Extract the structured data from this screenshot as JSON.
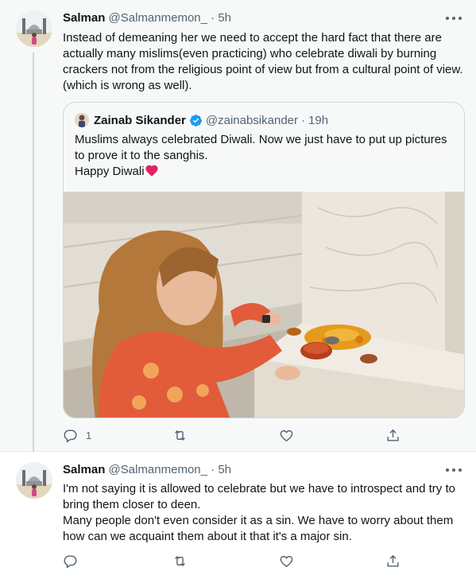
{
  "tweets": [
    {
      "author_name": "Salman",
      "author_handle": "@Salmanmemon_",
      "separator": "·",
      "time": "5h",
      "text": "Instead of demeaning her we need to accept the hard fact that there are actually many mislims(even practicing) who celebrate diwali by burning crackers not from the religious point of view but from a cultural point of view.(which is wrong as well).",
      "quote": {
        "author_name": "Zainab Sikander",
        "author_handle": "@zainabsikander",
        "separator": "·",
        "time": "19h",
        "line1": "Muslims always celebrated Diwali. Now we just have to put up pictures to prove it to the sanghis.",
        "line2": "Happy Diwali"
      },
      "reply_count": "1"
    },
    {
      "author_name": "Salman",
      "author_handle": "@Salmanmemon_",
      "separator": "·",
      "time": "5h",
      "text1": "I'm not saying it is allowed to celebrate but we have to introspect and try to bring them closer to deen.",
      "text2": "Many people don't even consider it as a sin. We have to worry about them how can we acquaint them about it that it's a major sin."
    }
  ],
  "colors": {
    "accent": "#1d9bf0",
    "heart": "#e0245e",
    "muted": "#536471",
    "thread_bg": "#f7f9f9"
  },
  "icons": [
    "more-icon",
    "verified-icon",
    "heart-emoji-icon",
    "reply-icon",
    "retweet-icon",
    "like-icon",
    "share-icon"
  ]
}
